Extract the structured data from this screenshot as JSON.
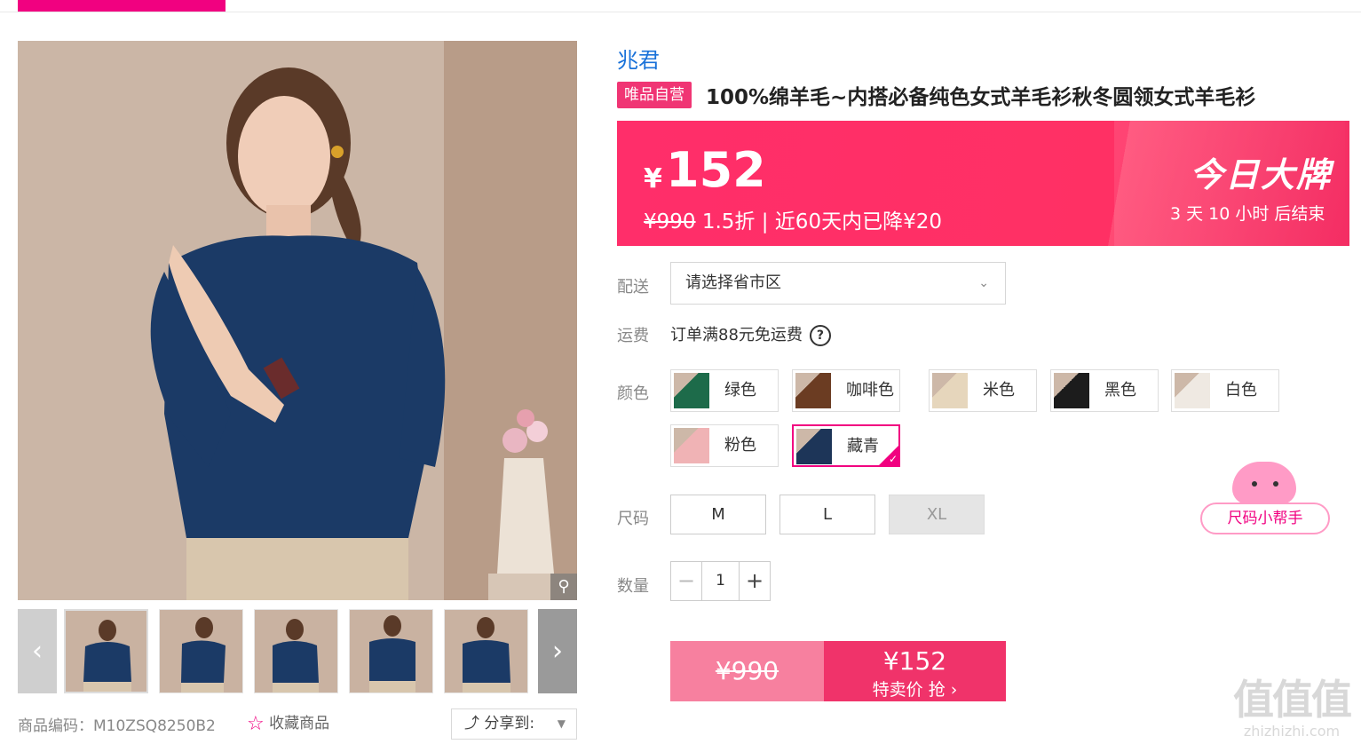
{
  "product": {
    "brand": "兆君",
    "tag": "唯品自营",
    "title": "100%绵羊毛~内搭必备纯色女式羊毛衫秋冬圆领女式羊毛衫",
    "code_label": "商品编码：M10ZSQ8250B2",
    "favorite_label": "收藏商品",
    "share_label": "分享到:"
  },
  "price": {
    "currency": "¥",
    "current": "152",
    "original": "¥990",
    "discount_text": "1.5折 | 近60天内已降¥20",
    "event_title": "今日大牌",
    "countdown": "3  天 10 小时 后结束"
  },
  "delivery": {
    "label": "配送",
    "select_value": "请选择省市区"
  },
  "shipping": {
    "label": "运费",
    "text": "订单满88元免运费"
  },
  "colors": {
    "label": "颜色",
    "options": [
      {
        "name": "绿色",
        "swatch": "#1d6b4a"
      },
      {
        "name": "咖啡色",
        "swatch": "#6b3c22"
      },
      {
        "name": "米色",
        "swatch": "#e6d6bc"
      },
      {
        "name": "黑色",
        "swatch": "#1c1c1c"
      },
      {
        "name": "白色",
        "swatch": "#efe9e2"
      },
      {
        "name": "粉色",
        "swatch": "#f0b3b5"
      },
      {
        "name": "藏青",
        "swatch": "#1d3558"
      }
    ],
    "selected": "藏青"
  },
  "sizes": {
    "label": "尺码",
    "options": [
      "M",
      "L",
      "XL"
    ],
    "disabled": [
      "XL"
    ]
  },
  "quantity": {
    "label": "数量",
    "value": "1",
    "minus": "−",
    "plus": "+"
  },
  "buy": {
    "original": "¥990",
    "price": "¥152",
    "label": "特卖价 抢 ›"
  },
  "helper": {
    "label": "尺码小帮手"
  },
  "watermark": {
    "big": "值值值",
    "small": "zhizhizhi.com"
  },
  "colors_theme": {
    "accent": "#f10180",
    "price_bg": "#ff3064",
    "brand_link": "#1a72d9"
  }
}
